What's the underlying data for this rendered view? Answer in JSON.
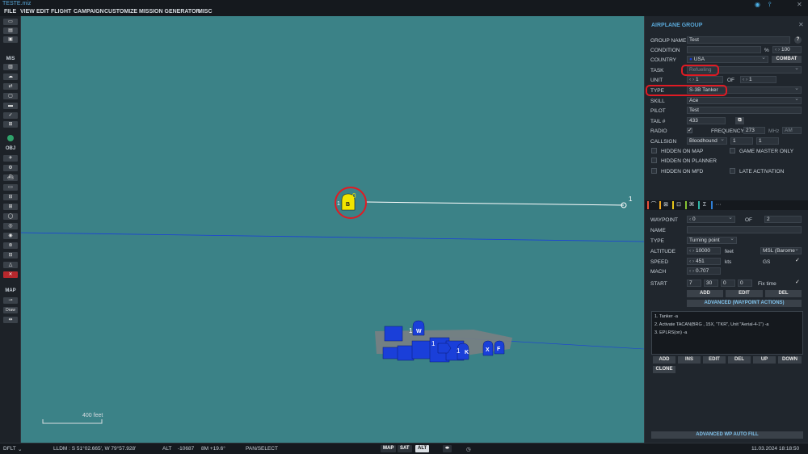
{
  "window": {
    "title": "TESTE.miz"
  },
  "menu": [
    "FILE",
    "VIEW",
    "EDIT",
    "FLIGHT",
    "CAMPAIGN",
    "CUSTOMIZE",
    "MISSION GENERATOR",
    "MISC"
  ],
  "left_toolbar": {
    "mis_label": "MIS",
    "obj_label": "OBJ",
    "map_label": "MAP",
    "draw_label": "Draw"
  },
  "map": {
    "waypoint_start_label": "B",
    "waypoint_start_num": "0",
    "waypoint_start_group": "1",
    "waypoint_end_num": "1",
    "scale_label": "400 feet",
    "carrier_labels": [
      "W",
      "1",
      "1",
      "1",
      "K",
      "X",
      "F"
    ],
    "colors": {
      "sea": "#3b8287",
      "friendly": "#1a3fd9",
      "tanker": "#f2e600",
      "route": "#ffffff",
      "highlight": "#e01b24"
    }
  },
  "status": {
    "profile": "DFLT",
    "coords": "LLDM : S 51°02.665', W 79°57.928'",
    "alt_label": "ALT",
    "alt_value": "-10687",
    "bm": "8M  +19.6°",
    "mode": "PAN/SELECT",
    "map_btn": "MAP",
    "sat_btn": "SAT",
    "alt_btn": "ALT",
    "datetime": "11.03.2024 18:18:50"
  },
  "panel": {
    "title": "AIRPLANE GROUP",
    "group_name_label": "GROUP NAME",
    "group_name": "Test",
    "condition_label": "CONDITION",
    "condition_pct": "%",
    "condition_value": "100",
    "country_label": "COUNTRY",
    "country": "USA",
    "combat_btn": "COMBAT",
    "task_label": "TASK",
    "task": "Refueling",
    "unit_label": "UNIT",
    "unit_value": "1",
    "of_label": "OF",
    "unit_of": "1",
    "type_label": "TYPE",
    "type": "S-3B Tanker",
    "skill_label": "SKILL",
    "skill": "Ace",
    "pilot_label": "PILOT",
    "pilot": "Test",
    "tail_label": "TAIL #",
    "tail": "433",
    "radio_label": "RADIO",
    "frequency_label": "FREQUENCY",
    "frequency": "273",
    "mhz": "MHz",
    "am": "AM",
    "callsign_label": "CALLSIGN",
    "callsign": "Bloodhound",
    "callsign_n1": "1",
    "callsign_n2": "1",
    "hidden_map": "HIDDEN ON MAP",
    "game_master": "GAME MASTER ONLY",
    "hidden_planner": "HIDDEN ON PLANNER",
    "hidden_mfd": "HIDDEN ON MFD",
    "late_activation": "LATE ACTIVATION",
    "tab_more": "···",
    "waypoint_label": "WAYPOINT",
    "waypoint": "0",
    "wp_of_label": "OF",
    "wp_of": "2",
    "name_label": "NAME",
    "wp_type_label": "TYPE",
    "wp_type": "Turning point",
    "altitude_label": "ALTITUDE",
    "altitude": "10000",
    "feet": "feet",
    "alt_ref": "MSL (Barome",
    "speed_label": "SPEED",
    "speed": "451",
    "kts": "kts",
    "gs": "GS",
    "mach_label": "MACH",
    "mach": "0.707",
    "start_label": "START",
    "start_d": "7",
    "start_h": "30",
    "start_m": "0",
    "start_s": "0",
    "fix_time": "Fix time",
    "add_btn": "ADD",
    "edit_btn": "EDIT",
    "del_btn": "DEL",
    "adv_btn": "ADVANCED (WAYPOINT ACTIONS)",
    "actions": [
      "1. Tanker -a",
      "2. Activate TACAN(BRG , 15X, \"TKR\", Unit \"Aerial-4-1\")  -a",
      "3. EPLRS(on)  -a"
    ],
    "act_add": "ADD",
    "act_ins": "INS",
    "act_edit": "EDIT",
    "act_del": "DEL",
    "act_up": "UP",
    "act_down": "DOWN",
    "act_clone": "CLONE",
    "auto_fill": "ADVANCED WP AUTO FILL"
  }
}
